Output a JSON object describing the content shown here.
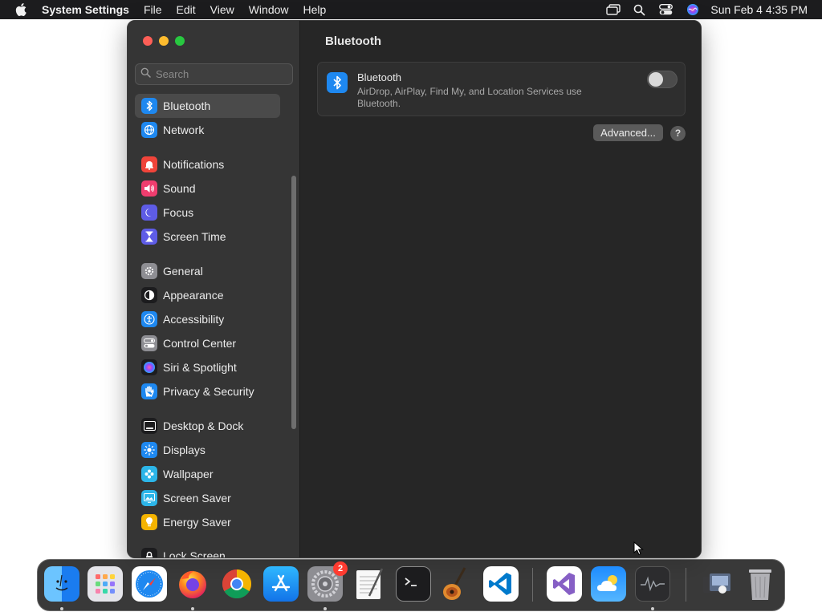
{
  "menubar": {
    "app_name": "System Settings",
    "menus": [
      "File",
      "Edit",
      "View",
      "Window",
      "Help"
    ],
    "clock": "Sun Feb 4  4:35 PM",
    "status_icons": [
      "screen-mirroring-icon",
      "spotlight-search-icon",
      "control-center-icon",
      "siri-icon"
    ]
  },
  "window": {
    "traffic_lights": [
      "close",
      "minimize",
      "maximize"
    ],
    "search": {
      "placeholder": "Search",
      "value": ""
    },
    "sidebar": {
      "items": [
        {
          "label": "Bluetooth",
          "icon": "bluetooth-icon",
          "color": "#1e88f0",
          "selected": true
        },
        {
          "label": "Network",
          "icon": "globe-icon",
          "color": "#1e88f0",
          "selected": false
        },
        {
          "label": "Notifications",
          "icon": "bell-icon",
          "color": "#f0443a",
          "selected": false
        },
        {
          "label": "Sound",
          "icon": "speaker-icon",
          "color": "#ef3d6e",
          "selected": false
        },
        {
          "label": "Focus",
          "icon": "moon-icon",
          "color": "#5e5ce6",
          "selected": false
        },
        {
          "label": "Screen Time",
          "icon": "hourglass-icon",
          "color": "#5e5ce6",
          "selected": false
        },
        {
          "label": "General",
          "icon": "gear-icon",
          "color": "#8e8e93",
          "selected": false
        },
        {
          "label": "Appearance",
          "icon": "appearance-icon",
          "color": "#1c1c1e",
          "selected": false
        },
        {
          "label": "Accessibility",
          "icon": "accessibility-icon",
          "color": "#1e88f0",
          "selected": false
        },
        {
          "label": "Control Center",
          "icon": "toggles-icon",
          "color": "#8e8e93",
          "selected": false
        },
        {
          "label": "Siri & Spotlight",
          "icon": "siri-icon",
          "color": "#b44bd6",
          "selected": false
        },
        {
          "label": "Privacy & Security",
          "icon": "hand-icon",
          "color": "#1e88f0",
          "selected": false
        },
        {
          "label": "Desktop & Dock",
          "icon": "dock-icon",
          "color": "#1c1c1e",
          "selected": false
        },
        {
          "label": "Displays",
          "icon": "sun-icon",
          "color": "#1e88f0",
          "selected": false
        },
        {
          "label": "Wallpaper",
          "icon": "flower-icon",
          "color": "#2cb5e8",
          "selected": false
        },
        {
          "label": "Screen Saver",
          "icon": "screen-saver-icon",
          "color": "#2cb5e8",
          "selected": false
        },
        {
          "label": "Energy Saver",
          "icon": "lightbulb-icon",
          "color": "#f5b400",
          "selected": false
        },
        {
          "label": "Lock Screen",
          "icon": "lock-icon",
          "color": "#1c1c1e",
          "selected": false
        }
      ]
    },
    "content": {
      "title": "Bluetooth",
      "bluetooth_card": {
        "title": "Bluetooth",
        "description": "AirDrop, AirPlay, Find My, and Location Services use Bluetooth.",
        "toggle_on": false
      },
      "advanced_label": "Advanced...",
      "help_label": "?"
    }
  },
  "dock": {
    "apps": [
      {
        "name": "Finder",
        "icon": "finder-icon",
        "running": true
      },
      {
        "name": "Launchpad",
        "icon": "launchpad-icon",
        "running": false
      },
      {
        "name": "Safari",
        "icon": "safari-icon",
        "running": false
      },
      {
        "name": "Firefox",
        "icon": "firefox-icon",
        "running": true
      },
      {
        "name": "Chrome",
        "icon": "chrome-icon",
        "running": false
      },
      {
        "name": "App Store",
        "icon": "app-store-icon",
        "running": false
      },
      {
        "name": "System Settings",
        "icon": "system-settings-icon",
        "running": true,
        "badge": "2"
      },
      {
        "name": "TextEdit",
        "icon": "textedit-icon",
        "running": false
      },
      {
        "name": "Terminal",
        "icon": "terminal-icon",
        "running": false
      },
      {
        "name": "GarageBand",
        "icon": "garageband-icon",
        "running": false
      },
      {
        "name": "VS Code",
        "icon": "vscode-icon",
        "running": false
      },
      {
        "name": "Visual Studio",
        "icon": "visual-studio-icon",
        "running": false
      },
      {
        "name": "Weather",
        "icon": "weather-icon",
        "running": false
      },
      {
        "name": "Activity Monitor",
        "icon": "activity-monitor-icon",
        "running": true
      },
      {
        "name": "Downloads",
        "icon": "downloads-folder-icon",
        "running": false
      },
      {
        "name": "Trash",
        "icon": "trash-icon",
        "running": false
      }
    ]
  }
}
